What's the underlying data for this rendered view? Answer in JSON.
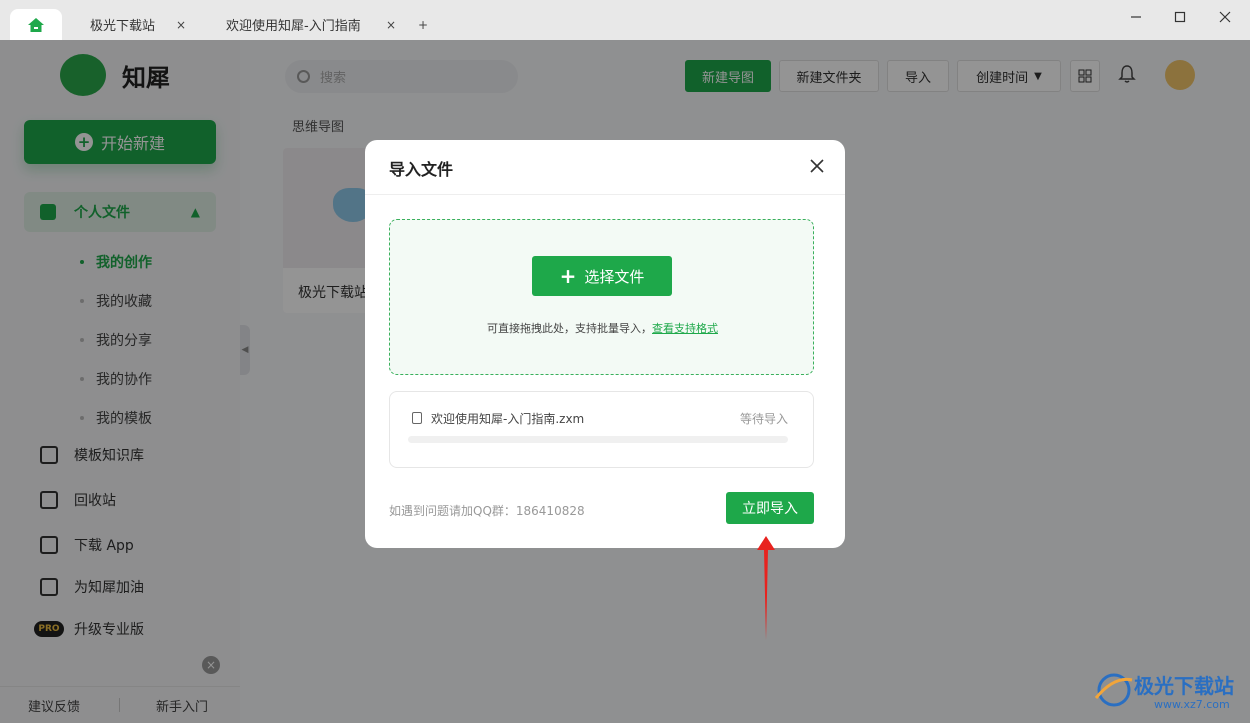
{
  "titlebar": {
    "tabs": [
      {
        "label": "极光下载站",
        "close": "×"
      },
      {
        "label": "欢迎使用知犀-入门指南",
        "close": "×"
      }
    ],
    "add_tab": "+"
  },
  "sidebar": {
    "logo_text": "知犀",
    "new_button": "开始新建",
    "personal_files": "个人文件",
    "sub_items": [
      "我的创作",
      "我的收藏",
      "我的分享",
      "我的协作",
      "我的模板"
    ],
    "items": [
      "模板知识库",
      "回收站",
      "下载 App",
      "为知犀加油",
      "升级专业版"
    ],
    "pro_badge": "PRO",
    "bottom": {
      "feedback": "建议反馈",
      "guide": "新手入门"
    }
  },
  "main": {
    "search_placeholder": "搜索",
    "toolbar": {
      "new_mindmap": "新建导图",
      "new_folder": "新建文件夹",
      "import": "导入",
      "sort": "创建时间"
    },
    "section_title": "思维导图",
    "card_name": "极光下载站"
  },
  "modal": {
    "title": "导入文件",
    "select_button": "选择文件",
    "drop_hint": "可直接拖拽此处，支持批量导入，",
    "formats_link": "查看支持格式",
    "file_name": "欢迎使用知犀-入门指南.zxm",
    "file_status": "等待导入",
    "progress": 0,
    "help_text": "如遇到问题请加QQ群：186410828",
    "import_button": "立即导入"
  },
  "watermark": {
    "text": "极光下载站",
    "url": "www.xz7.com"
  },
  "colors": {
    "accent": "#1ea84a",
    "annotation_arrow": "#e8231f"
  }
}
